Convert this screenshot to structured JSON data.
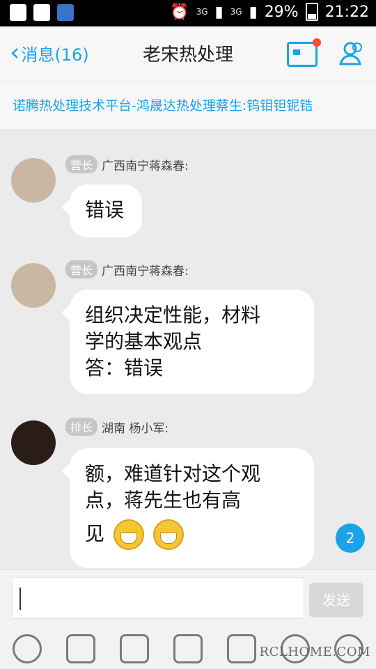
{
  "status_bar": {
    "network": "3G",
    "battery": "29%",
    "time": "21:22"
  },
  "header": {
    "back_label": "消息(16)",
    "title": "老宋热处理"
  },
  "announcement": "诺腾热处理技术平台-鸿晟达热处理蔡生:钨钼钽铌锆",
  "messages": [
    {
      "badge": "营长",
      "sender": "广西南宁蒋森春:",
      "text": "错误"
    },
    {
      "badge": "营长",
      "sender": "广西南宁蒋森春:",
      "lines": [
        "组织决定性能，材料",
        "学的基本观点",
        "答：错误"
      ]
    },
    {
      "badge": "排长",
      "sender": "湖南  杨小军:",
      "lines": [
        "额，难道针对这个观",
        "点，蒋先生也有高",
        "见"
      ],
      "emojis": [
        "grin-emoji",
        "grin-emoji"
      ]
    }
  ],
  "unread_count": "2",
  "composer": {
    "send_label": "发送",
    "placeholder": ""
  },
  "toolbar_icons": [
    "microphone-icon",
    "video-icon",
    "image-icon",
    "camera-icon",
    "red-packet-icon",
    "emoji-icon",
    "plus-icon"
  ],
  "watermark": "RCLHOME.COM",
  "colors": {
    "accent": "#1aa3e8",
    "background": "#ebebeb"
  }
}
